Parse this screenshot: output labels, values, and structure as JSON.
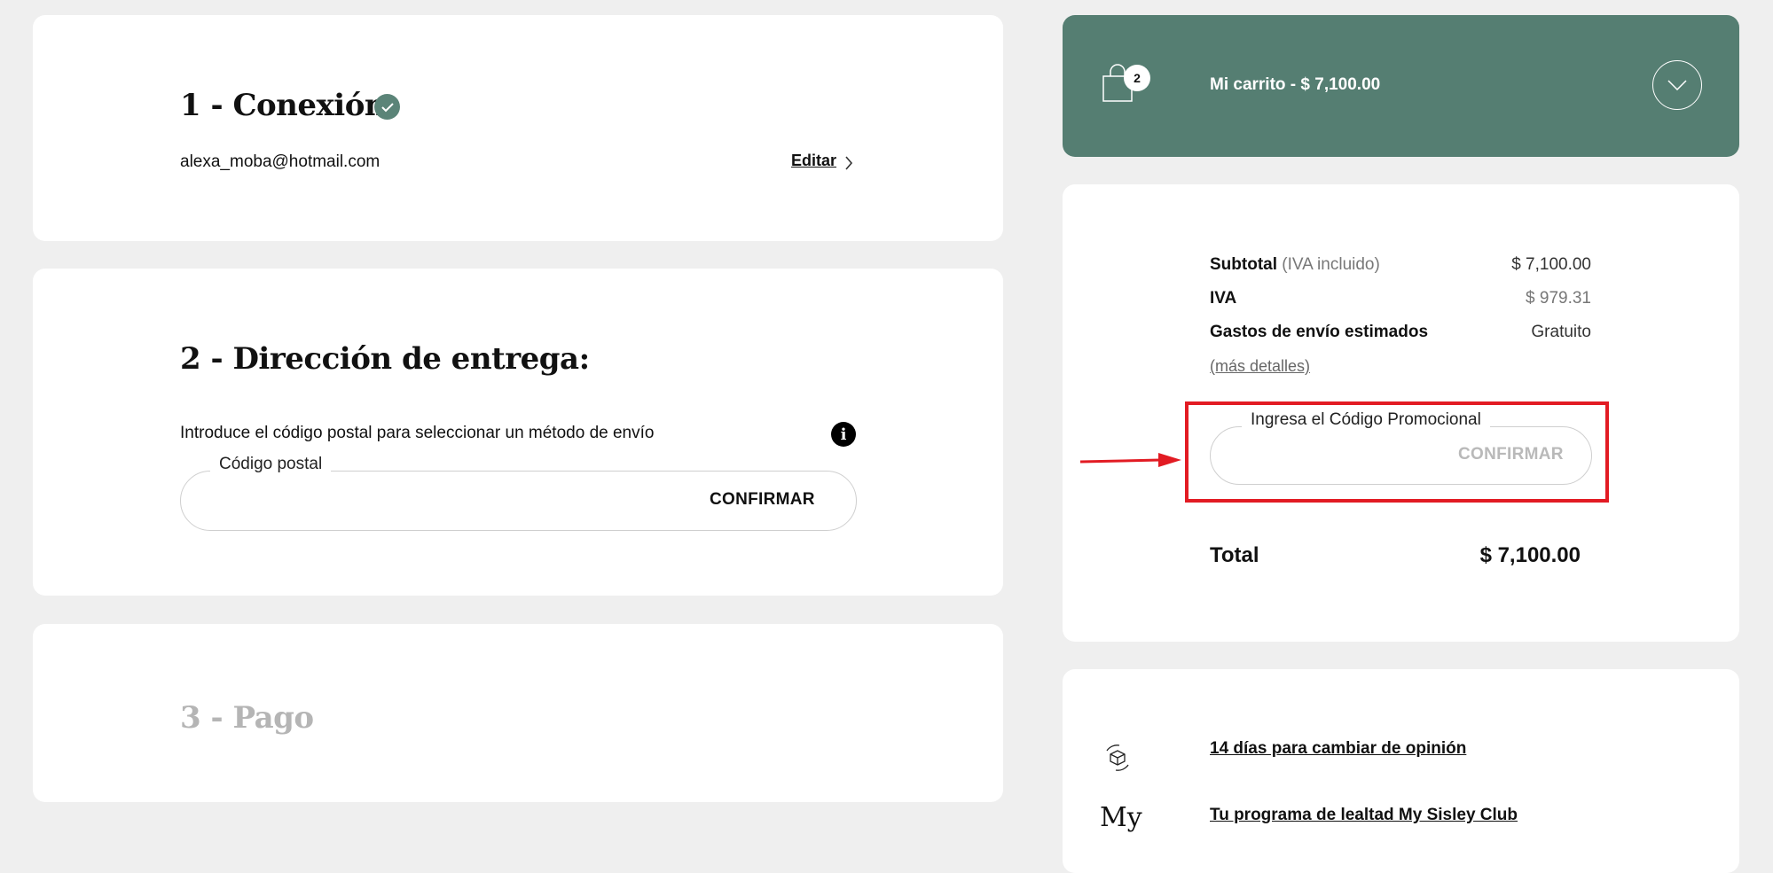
{
  "steps": {
    "connection": {
      "title": "1 - Conexión",
      "email": "alexa_moba@hotmail.com",
      "edit_label": "Editar"
    },
    "delivery": {
      "title": "2 - Dirección de entrega:",
      "intro": "Introduce el código postal para seleccionar un método de envío",
      "postal_label": "Código postal",
      "postal_value": "",
      "confirm_label": "CONFIRMAR"
    },
    "payment": {
      "title": "3 - Pago"
    }
  },
  "cart": {
    "count": "2",
    "title": "Mi carrito - $ 7,100.00"
  },
  "summary": {
    "subtotal_label": "Subtotal",
    "subtotal_note": "(IVA incluido)",
    "subtotal_value": "$ 7,100.00",
    "iva_label": "IVA",
    "iva_value": "$ 979.31",
    "shipping_label": "Gastos de envío estimados",
    "shipping_value": "Gratuito",
    "more_details": "(más detalles)",
    "promo_label": "Ingresa el Código Promocional",
    "promo_value": "",
    "promo_confirm": "CONFIRMAR",
    "total_label": "Total",
    "total_value": "$ 7,100.00"
  },
  "info": {
    "return_link": "14 días para cambiar de opinión",
    "loyalty_link": "Tu programa de lealtad My Sisley Club",
    "loyalty_icon_text": "My"
  },
  "colors": {
    "accent": "#557e72",
    "highlight": "#e21b23"
  }
}
